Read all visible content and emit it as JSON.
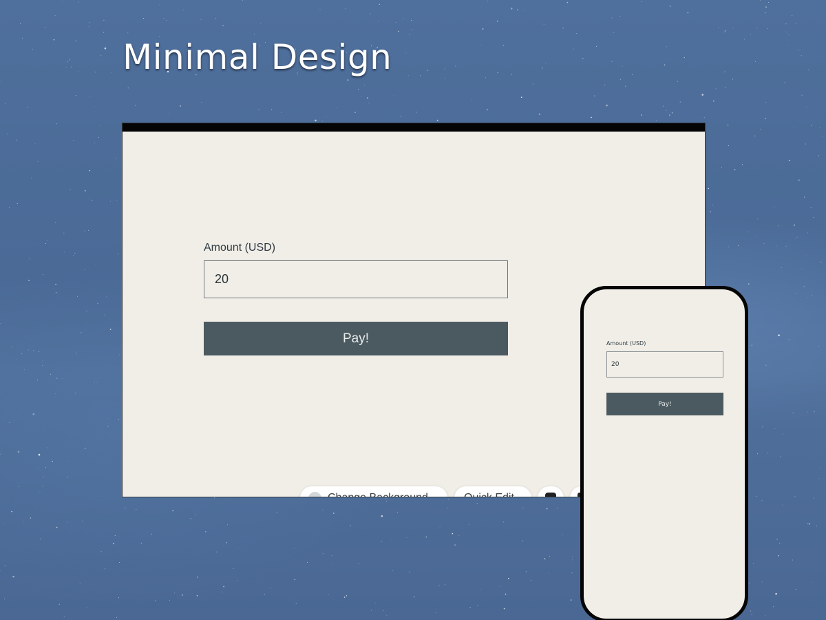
{
  "page": {
    "title": "Minimal Design"
  },
  "colors": {
    "background": "#4b6a96",
    "site_background": "#f1eee8",
    "button": "#4b5a60",
    "button_text": "#e8ebec",
    "frame": "#050505"
  },
  "desktop_preview": {
    "amount_label": "Amount (USD)",
    "amount_value": "20",
    "pay_button_label": "Pay!"
  },
  "toolbar": {
    "change_background_label": "Change Background",
    "change_background_icon": "background-icon",
    "quick_edit_label": "Quick Edit",
    "theme_icon": "theme-icon",
    "more_icon": "more-icon"
  },
  "mobile_preview": {
    "amount_label": "Amount (USD)",
    "amount_value": "20",
    "pay_button_label": "Pay!"
  }
}
